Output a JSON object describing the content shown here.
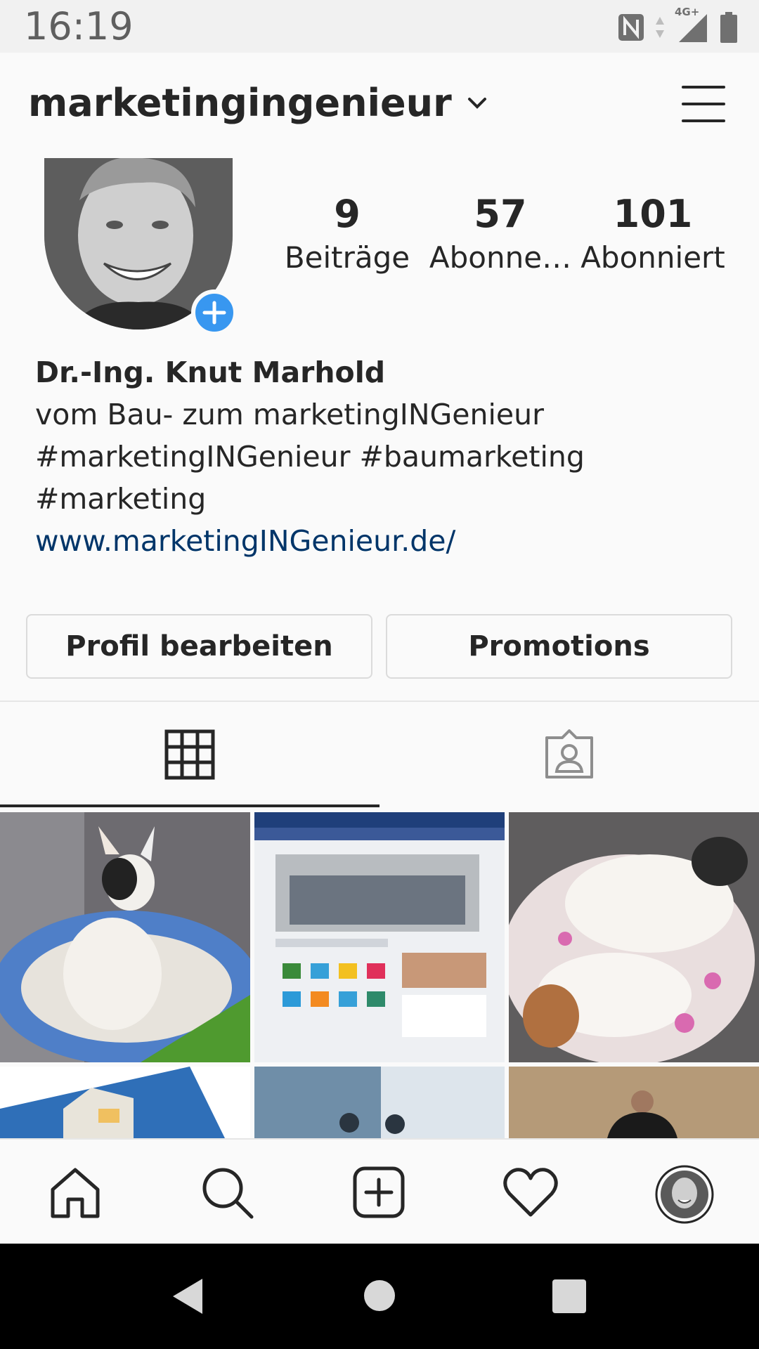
{
  "status_bar": {
    "time": "16:19",
    "network": "4G+",
    "icons": [
      "nfc-icon",
      "data-arrows-icon",
      "signal-icon",
      "battery-icon"
    ]
  },
  "header": {
    "username": "marketingingenieur",
    "dropdown_icon": "chevron-down-icon",
    "menu_icon": "hamburger-menu-icon"
  },
  "profile": {
    "add_story_icon": "plus-circle-icon",
    "stats": [
      {
        "value": "9",
        "label": "Beiträge"
      },
      {
        "value": "57",
        "label": "Abonne…"
      },
      {
        "value": "101",
        "label": "Abonniert"
      }
    ],
    "bio": {
      "name": "Dr.-Ing. Knut Marhold",
      "line1": "vom Bau- zum marketingINGenieur",
      "line2": "#marketingINGenieur #baumarketing",
      "line3": "#marketing",
      "link": "www.marketingINGenieur.de/"
    },
    "buttons": {
      "edit_profile": "Profil bearbeiten",
      "promotions": "Promotions"
    }
  },
  "tabs": [
    {
      "icon": "grid-icon",
      "active": true
    },
    {
      "icon": "tagged-person-icon",
      "active": false
    }
  ],
  "bottom_nav": [
    "home-icon",
    "search-icon",
    "add-post-icon",
    "heart-icon",
    "profile-avatar-icon"
  ],
  "system_nav": [
    "back-icon",
    "home-circle-icon",
    "recents-icon"
  ],
  "colors": {
    "accent": "#3897f0",
    "link": "#003569",
    "text": "#262626",
    "border": "#dbdbdb"
  }
}
